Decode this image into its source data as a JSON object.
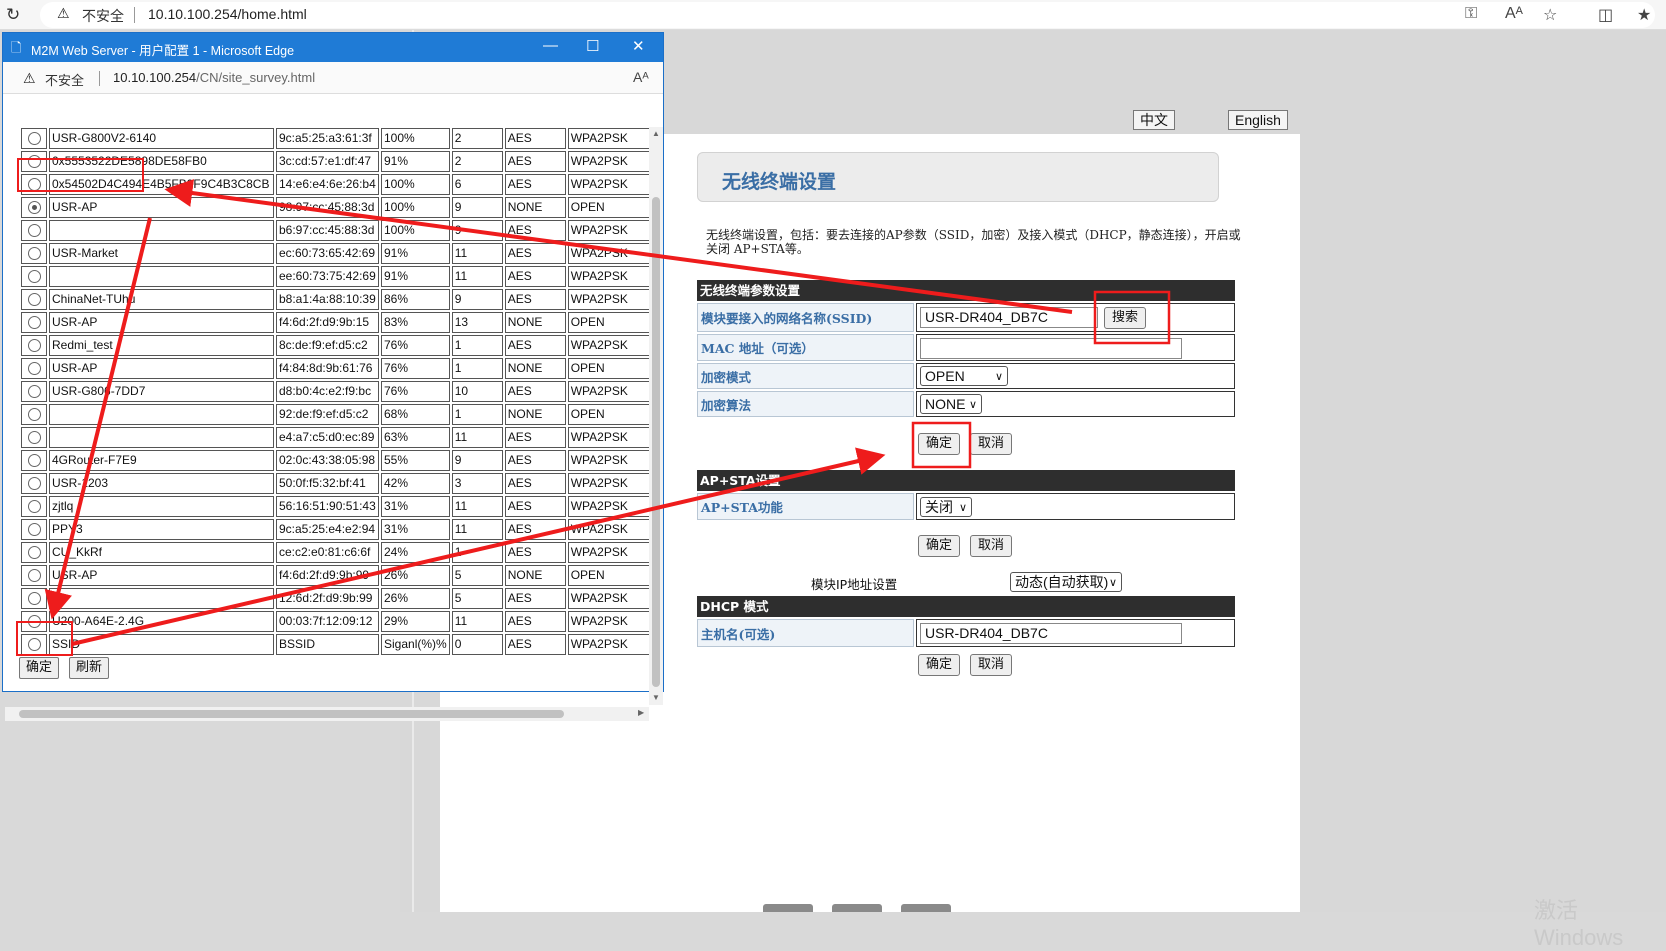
{
  "main_browser": {
    "insecure_label": "不安全",
    "url": "10.10.100.254/home.html"
  },
  "router": {
    "lang_zh": "中文",
    "lang_en": "English",
    "page_title": "无线终端设置",
    "description": "无线终端设置，包括：要去连接的AP参数（SSID，加密）及接入模式（DHCP，静态连接），开启或关闭 AP+STA等。",
    "sta_section": "无线终端参数设置",
    "ssid_label": "模块要接入的网络名称(SSID)",
    "ssid_value": "USR-DR404_DB7C",
    "search_label": "搜索",
    "mac_label": "MAC 地址（可选）",
    "mac_value": "",
    "enc_mode_label": "加密模式",
    "enc_mode_value": "OPEN",
    "enc_algo_label": "加密算法",
    "enc_algo_value": "NONE",
    "ok_label": "确定",
    "cancel_label": "取消",
    "apsta_section": "AP+STA设置",
    "apsta_label": "AP+STA功能",
    "apsta_value": "关闭",
    "ip_label": "模块IP地址设置",
    "ip_value": "动态(自动获取)",
    "dhcp_section": "DHCP 模式",
    "hostname_label": "主机名(可选)",
    "hostname_value": "USR-DR404_DB7C",
    "watermark": "激活 Windows"
  },
  "popup": {
    "title": "M2M Web Server - 用户配置 1 - Microsoft Edge",
    "insecure_label": "不安全",
    "url_host": "10.10.100.254",
    "url_path": "/CN/site_survey.html",
    "confirm_label": "确定",
    "refresh_label": "刷新",
    "networks": [
      {
        "selected": false,
        "ssid": "USR-G800V2-6140",
        "bssid": "9c:a5:25:a3:61:3f",
        "signal": "100%",
        "channel": "2",
        "cipher": "AES",
        "auth": "WPA2PSK"
      },
      {
        "selected": false,
        "ssid": "0x5553522DE5898DE58FB0",
        "bssid": "3c:cd:57:e1:df:47",
        "signal": "91%",
        "channel": "2",
        "cipher": "AES",
        "auth": "WPA2PSK"
      },
      {
        "selected": false,
        "ssid": "0x54502D4C494E4B5FB9F9C4B3C8CB",
        "bssid": "14:e6:e4:6e:26:b4",
        "signal": "100%",
        "channel": "6",
        "cipher": "AES",
        "auth": "WPA2PSK"
      },
      {
        "selected": true,
        "ssid": "USR-AP",
        "bssid": "98:97:cc:45:88:3d",
        "signal": "100%",
        "channel": "9",
        "cipher": "NONE",
        "auth": "OPEN"
      },
      {
        "selected": false,
        "ssid": "",
        "bssid": "b6:97:cc:45:88:3d",
        "signal": "100%",
        "channel": "9",
        "cipher": "AES",
        "auth": "WPA2PSK"
      },
      {
        "selected": false,
        "ssid": "USR-Market",
        "bssid": "ec:60:73:65:42:69",
        "signal": "91%",
        "channel": "11",
        "cipher": "AES",
        "auth": "WPA2PSK"
      },
      {
        "selected": false,
        "ssid": "",
        "bssid": "ee:60:73:75:42:69",
        "signal": "91%",
        "channel": "11",
        "cipher": "AES",
        "auth": "WPA2PSK"
      },
      {
        "selected": false,
        "ssid": "ChinaNet-TUhu",
        "bssid": "b8:a1:4a:88:10:39",
        "signal": "86%",
        "channel": "9",
        "cipher": "AES",
        "auth": "WPA2PSK"
      },
      {
        "selected": false,
        "ssid": "USR-AP",
        "bssid": "f4:6d:2f:d9:9b:15",
        "signal": "83%",
        "channel": "13",
        "cipher": "NONE",
        "auth": "OPEN"
      },
      {
        "selected": false,
        "ssid": "Redmi_test",
        "bssid": "8c:de:f9:ef:d5:c2",
        "signal": "76%",
        "channel": "1",
        "cipher": "AES",
        "auth": "WPA2PSK"
      },
      {
        "selected": false,
        "ssid": "USR-AP",
        "bssid": "f4:84:8d:9b:61:76",
        "signal": "76%",
        "channel": "1",
        "cipher": "NONE",
        "auth": "OPEN"
      },
      {
        "selected": false,
        "ssid": "USR-G806-7DD7",
        "bssid": "d8:b0:4c:e2:f9:bc",
        "signal": "76%",
        "channel": "10",
        "cipher": "AES",
        "auth": "WPA2PSK"
      },
      {
        "selected": false,
        "ssid": "",
        "bssid": "92:de:f9:ef:d5:c2",
        "signal": "68%",
        "channel": "1",
        "cipher": "NONE",
        "auth": "OPEN"
      },
      {
        "selected": false,
        "ssid": "",
        "bssid": "e4:a7:c5:d0:ec:89",
        "signal": "63%",
        "channel": "11",
        "cipher": "AES",
        "auth": "WPA2PSK"
      },
      {
        "selected": false,
        "ssid": "4GRouter-F7E9",
        "bssid": "02:0c:43:38:05:98",
        "signal": "55%",
        "channel": "9",
        "cipher": "AES",
        "auth": "WPA2PSK"
      },
      {
        "selected": false,
        "ssid": "USR-1203",
        "bssid": "50:0f:f5:32:bf:41",
        "signal": "42%",
        "channel": "3",
        "cipher": "AES",
        "auth": "WPA2PSK"
      },
      {
        "selected": false,
        "ssid": "zjtlq",
        "bssid": "56:16:51:90:51:43",
        "signal": "31%",
        "channel": "11",
        "cipher": "AES",
        "auth": "WPA2PSK"
      },
      {
        "selected": false,
        "ssid": "PPY3",
        "bssid": "9c:a5:25:e4:e2:94",
        "signal": "31%",
        "channel": "11",
        "cipher": "AES",
        "auth": "WPA2PSK"
      },
      {
        "selected": false,
        "ssid": "CU_KkRf",
        "bssid": "ce:c2:e0:81:c6:6f",
        "signal": "24%",
        "channel": "1",
        "cipher": "AES",
        "auth": "WPA2PSK"
      },
      {
        "selected": false,
        "ssid": "USR-AP",
        "bssid": "f4:6d:2f:d9:9b:99",
        "signal": "26%",
        "channel": "5",
        "cipher": "NONE",
        "auth": "OPEN"
      },
      {
        "selected": false,
        "ssid": "",
        "bssid": "12:6d:2f:d9:9b:99",
        "signal": "26%",
        "channel": "5",
        "cipher": "AES",
        "auth": "WPA2PSK"
      },
      {
        "selected": false,
        "ssid": "U200-A64E-2.4G",
        "bssid": "00:03:7f:12:09:12",
        "signal": "29%",
        "channel": "11",
        "cipher": "AES",
        "auth": "WPA2PSK"
      },
      {
        "selected": false,
        "ssid": "SSID",
        "bssid": "BSSID",
        "signal": "Siganl(%)%",
        "channel": "0",
        "cipher": "AES",
        "auth": "WPA2PSK"
      }
    ]
  },
  "annotation_color": "#ee1c1c",
  "icons": [
    "reload-icon",
    "warning-icon",
    "key-icon",
    "read-aloud-icon",
    "favorites-icon",
    "split-screen-icon",
    "collections-icon",
    "document-icon",
    "minimize-icon",
    "maximize-icon",
    "close-icon"
  ]
}
